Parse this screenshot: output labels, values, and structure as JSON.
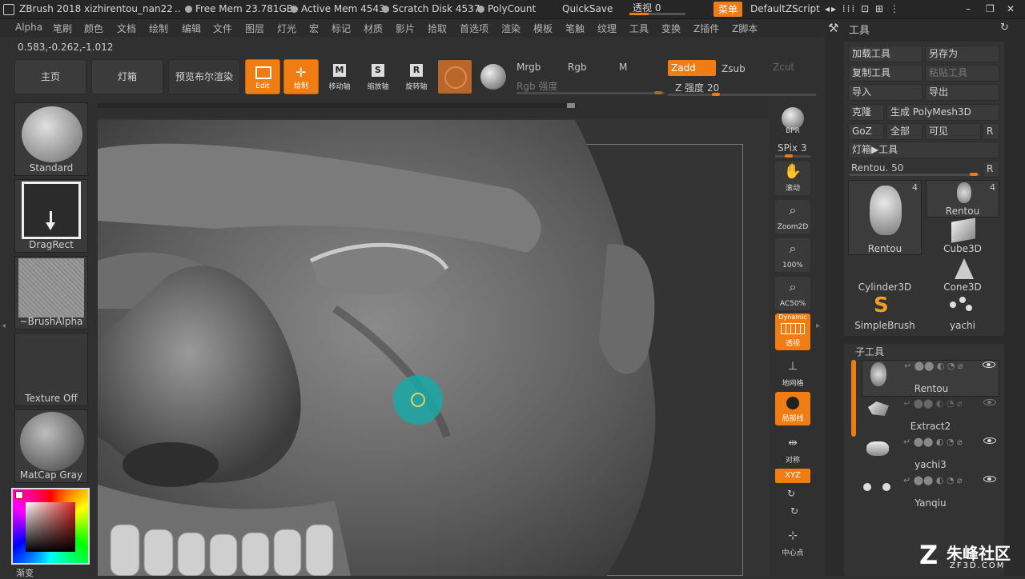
{
  "titlebar": {
    "app": "ZBrush 2018",
    "document": "xizhirentou_nan22",
    "ellipsis": "..",
    "free_mem": "Free Mem 23.781GB",
    "active_mem": "Active Mem 4543",
    "scratch_disk": "Scratch Disk 4537",
    "polycount": "PolyCount",
    "quicksave": "QuickSave",
    "perspective": "透视 0",
    "menu": "菜单",
    "zscript": "DefaultZScript"
  },
  "menubar": [
    "Alpha",
    "笔刷",
    "颜色",
    "文档",
    "绘制",
    "编辑",
    "文件",
    "图层",
    "灯光",
    "宏",
    "标记",
    "材质",
    "影片",
    "拾取",
    "首选项",
    "渲染",
    "模板",
    "笔触",
    "纹理",
    "工具",
    "变换",
    "Z插件",
    "Z脚本"
  ],
  "coords": "0.583,-0.262,-1.012",
  "topbar": {
    "home": "主页",
    "lightbox": "灯箱",
    "bpr_preview": "预览布尔渲染",
    "edit": "Edit",
    "draw": "绘制",
    "move": "移动轴",
    "scale": "缩放轴",
    "rotate": "旋转轴",
    "mrgb": "Mrgb",
    "rgb": "Rgb",
    "m": "M",
    "rgb_intensity": "Rgb 强度",
    "zadd": "Zadd",
    "zsub": "Zsub",
    "zcut": "Zcut",
    "z_intensity": "Z 强度 20",
    "z_intensity_value": 20
  },
  "leftshelf": {
    "brush": "Standard",
    "stroke": "DragRect",
    "alpha": "~BrushAlpha",
    "texture": "Texture Off",
    "material": "MatCap Gray",
    "gradient": "渐变"
  },
  "righttools": {
    "bpr": "BPR",
    "spix": "SPix 3",
    "scroll": "滚动",
    "zoom2d": "Zoom2D",
    "zoom100": "100%",
    "ac50": "AC50%",
    "dynamic": "Dynamic",
    "perspective": "透视",
    "floor": "地网格",
    "local": "局部线",
    "symmetry": "对称",
    "xyz": "XYZ",
    "center": "中心点"
  },
  "toolpanel": {
    "title": "工具",
    "load": "加载工具",
    "save_as": "另存为",
    "copy": "复制工具",
    "paste": "粘贴工具",
    "import": "导入",
    "export": "导出",
    "clone": "克隆",
    "make_polymesh": "生成 PolyMesh3D",
    "goz": "GoZ",
    "all": "全部",
    "visible": "可见",
    "r": "R",
    "lightbox_tools": "灯箱▶工具",
    "rentou_slider": "Rentou. 50",
    "thumbs": [
      {
        "name": "Rentou",
        "count": "4"
      },
      {
        "name": "Rentou",
        "count": "4"
      },
      {
        "name": "Cube3D"
      },
      {
        "name": "Cylinder3D"
      },
      {
        "name": "Cone3D"
      },
      {
        "name": "SimpleBrush"
      },
      {
        "name": "yachi"
      }
    ],
    "subtool_title": "子工具",
    "subtools": [
      "Rentou",
      "Extract2",
      "yachi3",
      "Yanqiu"
    ]
  },
  "watermark": {
    "brand": "朱峰社区",
    "url": "ZF3D.COM"
  },
  "colors": {
    "accent": "#f07c14",
    "cursor": "#1aa8a8"
  }
}
